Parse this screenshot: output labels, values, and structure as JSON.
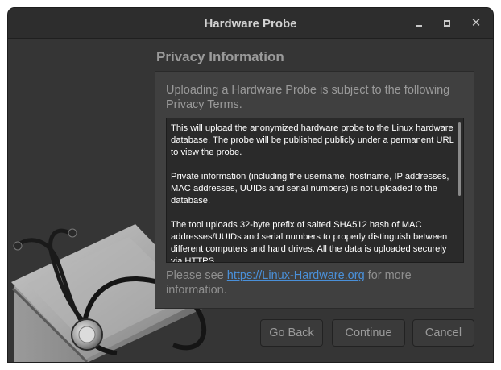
{
  "window": {
    "title": "Hardware Probe",
    "controls": {
      "minimize_icon": "minimize-icon",
      "maximize_icon": "maximize-icon",
      "close_label": "✕"
    }
  },
  "page": {
    "heading": "Privacy Information",
    "intro": "Uploading a Hardware Probe is subject to the following Privacy Terms.",
    "terms": [
      "This will upload the anonymized hardware probe to the Linux hardware database. The probe will be published publicly under a permanent URL to view the probe.",
      "Private information (including the username, hostname, IP addresses, MAC addresses, UUIDs and serial numbers) is not uploaded to the database.",
      "The tool uploads 32-byte prefix of salted SHA512 hash of MAC addresses/UUIDs and serial numbers to properly distinguish between different computers and hard drives. All the data is uploaded securely via HTTPS."
    ],
    "footer": {
      "prefix": "Please see ",
      "link": "https://Linux-Hardware.org",
      "suffix": " for more information."
    }
  },
  "buttons": {
    "back": "Go Back",
    "continue": "Continue",
    "cancel": "Cancel"
  },
  "illustration": {
    "icon": "stethoscope-on-laptop-icon"
  }
}
